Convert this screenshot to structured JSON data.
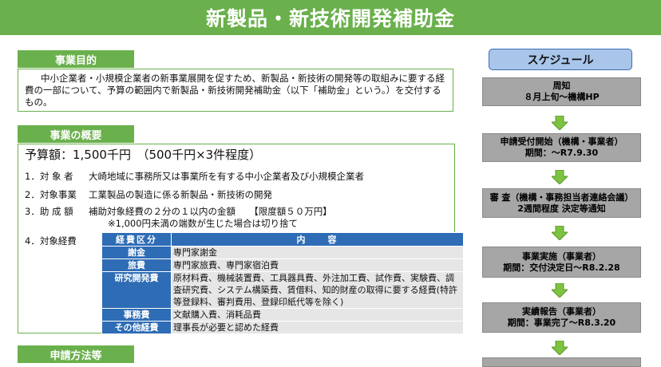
{
  "title": "新製品・新技術開発補助金",
  "purpose": {
    "heading": "事業目的",
    "text": "中小企業者・小規模企業者の新事業展開を促すため、新製品・新技術の開発等の取組みに要する経費の一部について、予算の範囲内で新製品・新技術開発補助金（以下「補助金」という。）を交付するもの。"
  },
  "overview": {
    "heading": "事業の概要",
    "budget": "予算額：1,500千円　（500千円×3件程度）",
    "items": [
      {
        "num": "1．対 象 者",
        "text": "大崎地域に事務所又は事業所を有する中小企業者及び小規模企業者"
      },
      {
        "num": "2．対象事業",
        "text": "工業製品の製造に係る新製品・新技術の開発"
      },
      {
        "num": "3．助 成 額",
        "text": "補助対象経費の２分の１以内の金額　　【限度額５０万円】"
      }
    ],
    "note": "※1,000円未満の端数が生じた場合は切り捨て",
    "expense_label": "4．対象経費",
    "table_headers": [
      "経費区分",
      "内　　容"
    ],
    "table_rows": [
      {
        "category": "謝金",
        "content": "専門家謝金"
      },
      {
        "category": "旅費",
        "content": "専門家旅費、専門家宿泊費"
      },
      {
        "category": "研究開発費",
        "content": "原材料費、機械装置費、工具器具費、外注加工費、試作費、実験費、調査研究費、システム構築費、賃借料、知的財産の取得に要する経費(特許等登録料、審判費用、登録印紙代等を除く)"
      },
      {
        "category": "事務費",
        "content": "文献購入費、消耗品費"
      },
      {
        "category": "その他経費",
        "content": "理事長が必要と認めた経費"
      }
    ]
  },
  "application": {
    "heading": "申請方法等"
  },
  "schedule": {
    "title": "スケジュール",
    "steps": [
      {
        "line1": "周知",
        "line2": "８月上旬～機構HP"
      },
      {
        "line1": "申請受付開始（機構・事業者）",
        "line2": "期間：～R7.9.30"
      },
      {
        "line1": "審 査（機構・事務担当者連絡会議）",
        "line2": "2週間程度 決定等通知"
      },
      {
        "line1": "事業実施（事業者）",
        "line2": "期間：交付決定日～R8.2.28"
      },
      {
        "line1": "実績報告（事業者）",
        "line2": "期間：事業完了～R8.3.20"
      }
    ]
  },
  "colors": {
    "green": "#6ab04c",
    "blue": "#2e6cb5",
    "step_gray": "#a6a6a6",
    "arrow_green": "#7ec242"
  }
}
